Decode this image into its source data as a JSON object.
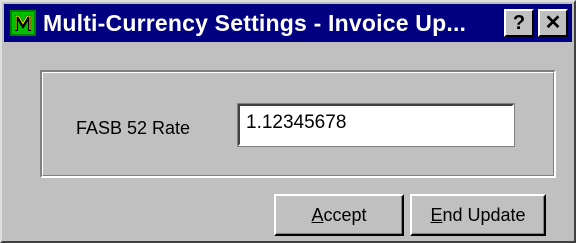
{
  "window": {
    "title": "Multi-Currency Settings - Invoice Up...",
    "help_label": "?",
    "close_label": "✕"
  },
  "form": {
    "rate_label": "FASB 52 Rate",
    "rate_value": "1.12345678"
  },
  "buttons": {
    "accept_mnemonic": "A",
    "accept_rest": "ccept",
    "end_mnemonic": "E",
    "end_rest": "nd Update"
  }
}
